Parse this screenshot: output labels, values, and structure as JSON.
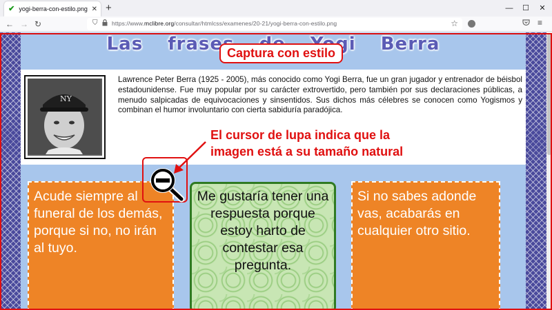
{
  "browser": {
    "tab_title": "yogi-berra-con-estilo.png (Ima",
    "tab_close": "✕",
    "new_tab": "+",
    "window": {
      "minimize": "—",
      "maximize": "☐",
      "close": "✕"
    },
    "nav": {
      "back": "←",
      "forward": "→",
      "reload": "↻"
    },
    "url_prefix": "https://www.",
    "url_host": "mclibre.org",
    "url_path": "/consultar/htmlcss/examenes/20-21/yogi-berra-con-estilo.png",
    "star": "☆",
    "menu": "≡"
  },
  "page": {
    "heading": "Las frases de Yogi Berra",
    "bio": "Lawrence Peter Berra (1925 - 2005), más conocido como Yogi Berra, fue un gran jugador y entrenador de béisbol estadounidense. Fue muy popular por su carácter extrovertido, pero también por sus declaraciones públicas, a menudo salpicadas de equivocaciones y sinsentidos. Sus dichos más célebres se conocen como Yogismos y combinan el humor involuntario con cierta sabiduría paradójica.",
    "quotes": [
      "Acude siempre al funeral de los demás, porque si no, no irán al tuyo.",
      "Me gustaría tener una respuesta porque estoy harto de contestar esa pregunta.",
      "Si no sabes adonde vas, acabarás en cualquier otro sitio."
    ]
  },
  "annotations": {
    "capture_label": "Captura con estilo",
    "cursor_note_line1": "El cursor de lupa indica que la",
    "cursor_note_line2": "imagen está a su tamaño natural"
  },
  "colors": {
    "page_bg": "#a8c6ec",
    "heading": "#5b5bb5",
    "orange_box": "#ee8426",
    "green_border": "#2f7a22",
    "annotation_red": "#e01010"
  }
}
